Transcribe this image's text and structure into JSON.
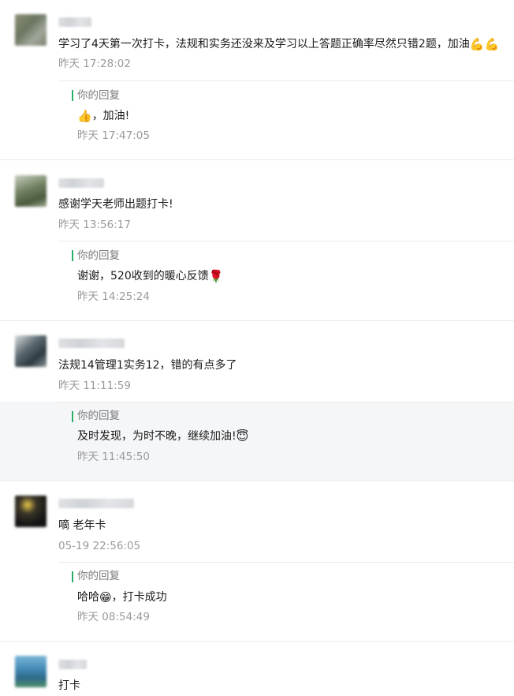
{
  "comments": [
    {
      "text": "学习了4天第一次打卡，法规和实务还没来及学习以上答题正确率尽然只错2题，加油",
      "emojis": "💪💪",
      "time": "昨天 17:28:02",
      "reply": {
        "label": "你的回复",
        "prefix_emoji": "👍",
        "text": "，加油!",
        "time": "昨天 17:47:05"
      }
    },
    {
      "text": "感谢学天老师出题打卡!",
      "time": "昨天 13:56:17",
      "reply": {
        "label": "你的回复",
        "text": "谢谢，520收到的暖心反馈",
        "suffix_emoji": "🌹",
        "time": "昨天 14:25:24"
      }
    },
    {
      "text": "法规14管理1实务12，错的有点多了",
      "time": "昨天 11:11:59",
      "reply": {
        "label": "你的回复",
        "text": "及时发现，为时不晚，继续加油!",
        "suffix_emoji": "😇",
        "time": "昨天 11:45:50"
      }
    },
    {
      "text": "嘀 老年卡",
      "time": "05-19 22:56:05",
      "reply": {
        "label": "你的回复",
        "text": "哈哈",
        "mid_emoji": "😁",
        "text2": "，打卡成功",
        "time": "昨天 08:54:49"
      }
    },
    {
      "text": "打卡"
    }
  ],
  "colors": {
    "accent": "#2aae67",
    "muted": "#9a9a9a",
    "reply_bg": "#f5f6f8"
  }
}
